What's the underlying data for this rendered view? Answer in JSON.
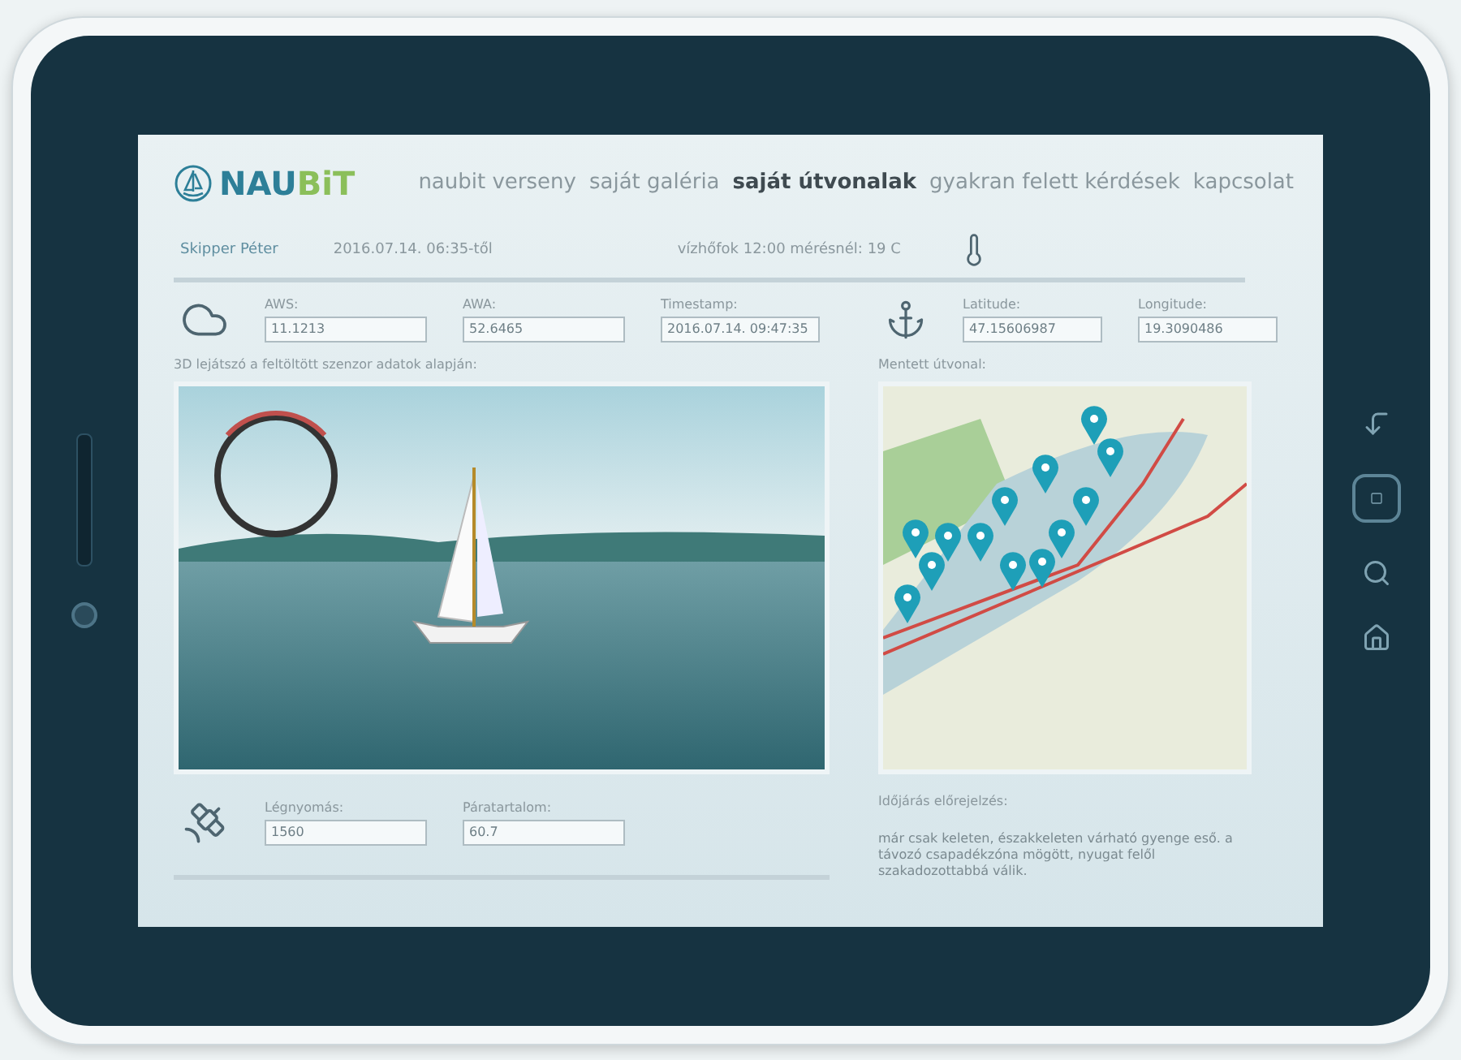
{
  "logo": {
    "primary": "NAU",
    "accent": "BiT"
  },
  "nav": [
    {
      "label": "naubit verseny",
      "selected": false
    },
    {
      "label": "saját galéria",
      "selected": false
    },
    {
      "label": "saját útvonalak",
      "selected": true
    },
    {
      "label": "gyakran felett kérdések",
      "selected": false
    },
    {
      "label": "kapcsolat",
      "selected": false
    }
  ],
  "info": {
    "skipper": "Skipper Péter",
    "since": "2016.07.14. 06:35-től",
    "water_temp": "vízhőfok 12:00 mérésnél: 19 C"
  },
  "wind_fields": [
    {
      "label": "AWS:",
      "value": "11.1213"
    },
    {
      "label": "AWA:",
      "value": "52.6465"
    },
    {
      "label": "Timestamp:",
      "value": "2016.07.14. 09:47:35"
    }
  ],
  "position_fields": [
    {
      "label": "Latitude:",
      "value": "47.15606987"
    },
    {
      "label": "Longitude:",
      "value": "19.3090486"
    }
  ],
  "player": {
    "caption": "3D lejátszó a feltöltött szenzor adatok alapján:"
  },
  "map": {
    "caption": "Mentett útvonal:"
  },
  "weather_fields": [
    {
      "label": "Légnyomás:",
      "value": "1560"
    },
    {
      "label": "Páratartalom:",
      "value": "60.7"
    }
  ],
  "forecast": {
    "title": "Időjárás előrejelzés:",
    "text": "már csak keleten, északkeleten várható gyenge eső. a távozó csapadékzóna mögött, nyugat felől szakadozottabbá válik."
  }
}
